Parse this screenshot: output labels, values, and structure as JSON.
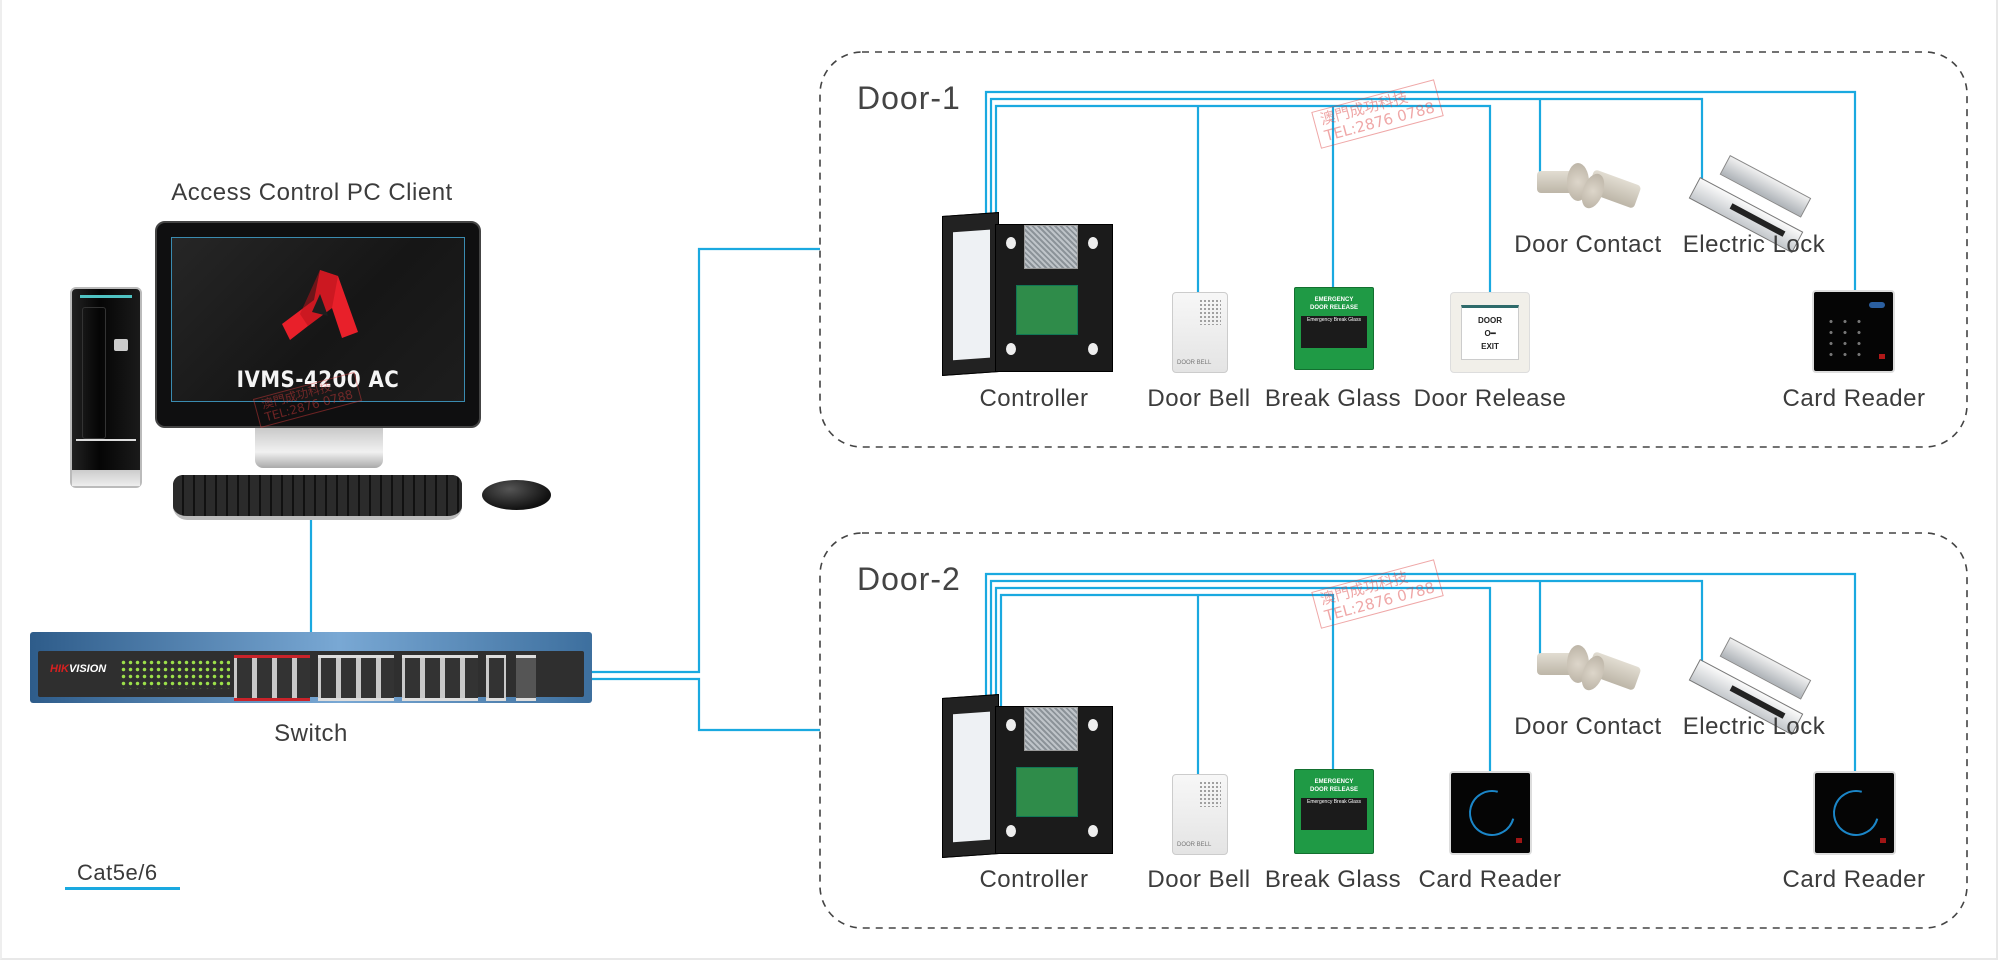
{
  "pc": {
    "label": "Access Control PC Client",
    "screen_text": "IVMS-4200 AC",
    "logo_color": "#e8202a"
  },
  "switch": {
    "label": "Switch",
    "brand_red": "HIK",
    "brand_white": "VISION"
  },
  "legend": {
    "label": "Cat5e/6",
    "line_color": "#1aa9e0"
  },
  "wire_color": "#1aa9e0",
  "doors": [
    {
      "title": "Door-1",
      "devices": {
        "controller": "Controller",
        "door_bell": "Door Bell",
        "break_glass": "Break Glass",
        "door_release": "Door Release",
        "door_contact": "Door Contact",
        "electric_lock": "Electric Lock",
        "card_reader": "Card Reader"
      }
    },
    {
      "title": "Door-2",
      "devices": {
        "controller": "Controller",
        "door_bell": "Door Bell",
        "break_glass": "Break Glass",
        "card_reader_1": "Card Reader",
        "door_contact": "Door Contact",
        "electric_lock": "Electric Lock",
        "card_reader_2": "Card Reader"
      }
    }
  ],
  "device_text": {
    "door_bell_tag": "DOOR BELL",
    "break_glass_header": "EMERGENCY\nDOOR RELEASE",
    "break_glass_panel": "Emergency Break Glass",
    "exit_top": "DOOR",
    "exit_key": "O━",
    "exit_bottom": "EXIT"
  },
  "watermark": {
    "line1": "澳門成功科技",
    "line2": "TEL:2876 0788"
  }
}
